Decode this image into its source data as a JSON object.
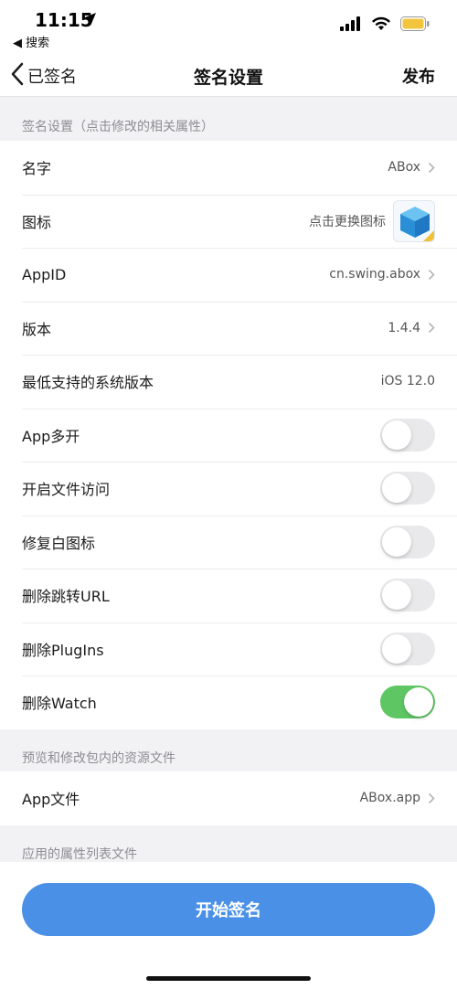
{
  "status_bar": {
    "time": "11:15",
    "back_label": "◀ 搜索"
  },
  "nav": {
    "back_label": "已签名",
    "title": "签名设置",
    "action": "发布"
  },
  "section1": {
    "header": "签名设置（点击修改的相关属性）",
    "rows": {
      "name": {
        "label": "名字",
        "value": "ABox"
      },
      "icon": {
        "label": "图标",
        "value": "点击更换图标"
      },
      "appid": {
        "label": "AppID",
        "value": "cn.swing.abox"
      },
      "version": {
        "label": "版本",
        "value": "1.4.4"
      },
      "min_os": {
        "label": "最低支持的系统版本",
        "value": "iOS 12.0"
      },
      "multi_open": {
        "label": "App多开",
        "on": false
      },
      "file_access": {
        "label": "开启文件访问",
        "on": false
      },
      "fix_icon": {
        "label": "修复白图标",
        "on": false
      },
      "remove_url": {
        "label": "删除跳转URL",
        "on": false
      },
      "remove_plugins": {
        "label": "删除PlugIns",
        "on": false
      },
      "remove_watch": {
        "label": "删除Watch",
        "on": true
      }
    }
  },
  "section2": {
    "header": "预览和修改包内的资源文件",
    "app_file": {
      "label": "App文件",
      "value": "ABox.app"
    }
  },
  "section3": {
    "header": "应用的属性列表文件"
  },
  "primary_button": "开始签名",
  "colors": {
    "accent": "#4a90e6",
    "toggle_on": "#5fc664",
    "toggle_off": "#e9e9eb"
  }
}
